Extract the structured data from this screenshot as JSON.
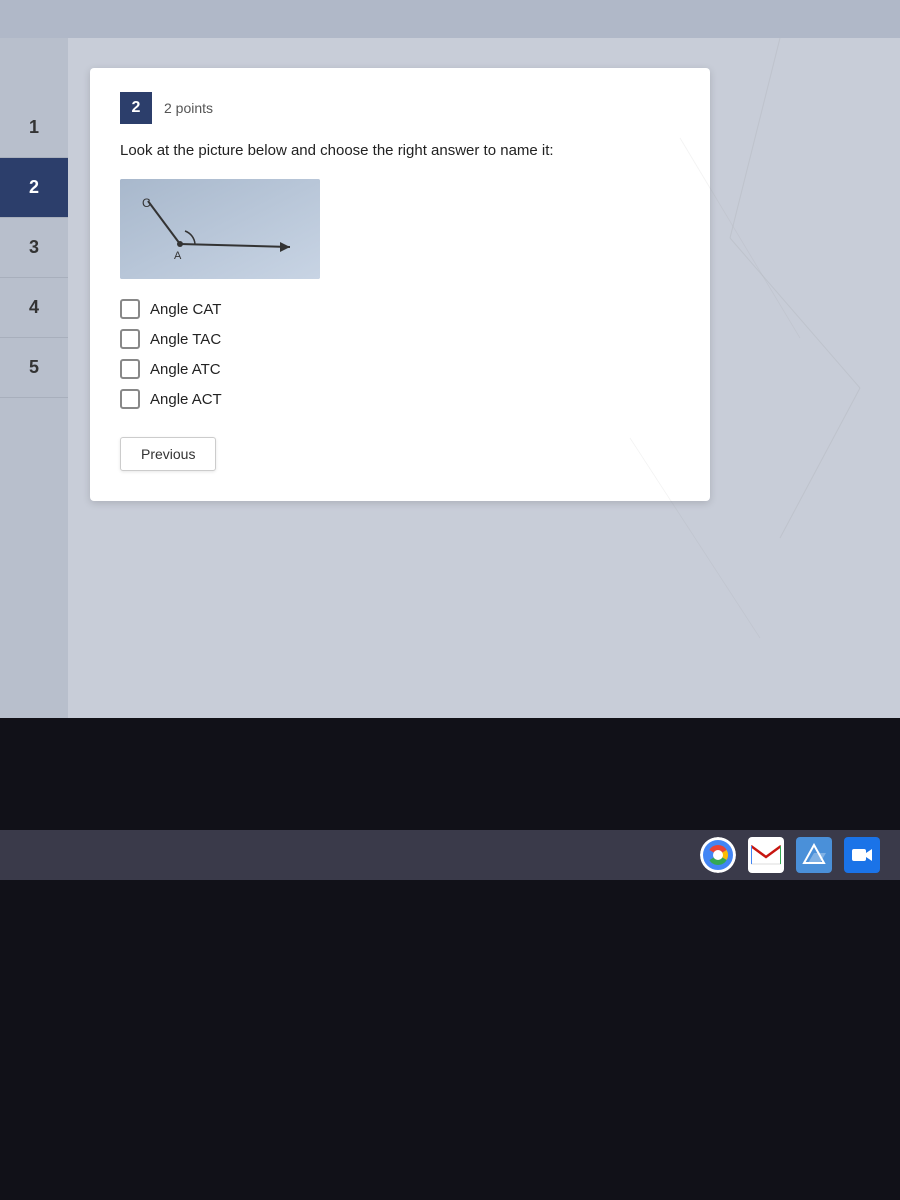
{
  "topBar": {
    "bg": "#b0b8c8"
  },
  "sidebar": {
    "items": [
      {
        "label": "1",
        "active": false
      },
      {
        "label": "2",
        "active": true
      },
      {
        "label": "3",
        "active": false
      },
      {
        "label": "4",
        "active": false
      },
      {
        "label": "5",
        "active": false
      }
    ]
  },
  "question": {
    "number": "2",
    "points_label": "2 points",
    "text": "Look at the picture below and choose the right answer to name it:",
    "choices": [
      {
        "id": "a",
        "label": "Angle CAT"
      },
      {
        "id": "b",
        "label": "Angle TAC"
      },
      {
        "id": "c",
        "label": "Angle ATC"
      },
      {
        "id": "d",
        "label": "Angle ACT"
      }
    ],
    "previous_button": "Previous"
  },
  "taskbar": {
    "icons": [
      {
        "name": "chrome",
        "label": "Chrome"
      },
      {
        "name": "gmail",
        "label": "Gmail"
      },
      {
        "name": "files",
        "label": "Files"
      },
      {
        "name": "meet",
        "label": "Meet"
      }
    ]
  }
}
